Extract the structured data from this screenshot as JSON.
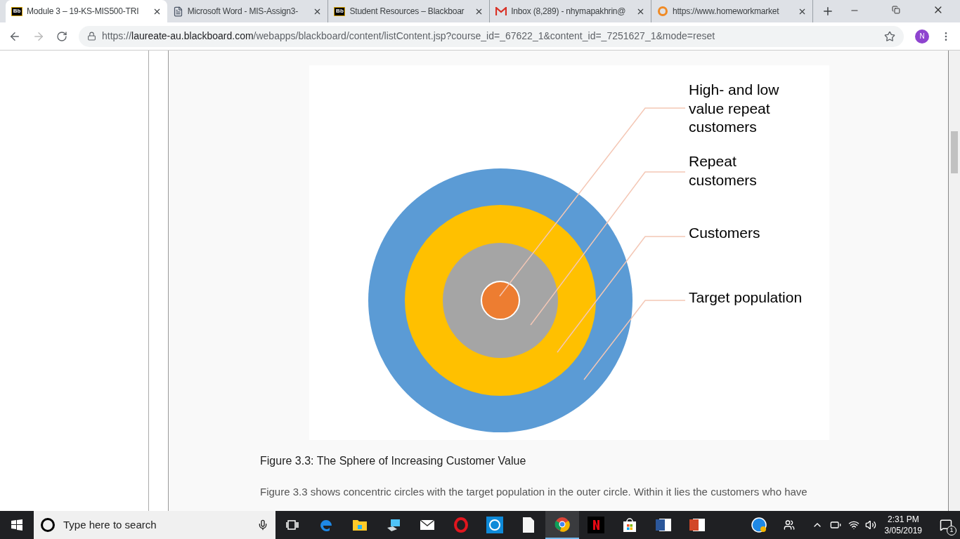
{
  "tabs": [
    {
      "label": "Module 3 – 19-KS-MIS500-TRI",
      "kind": "bb",
      "logo": "Bb",
      "selected": true
    },
    {
      "label": "Microsoft Word - MIS-Assign3-",
      "kind": "doc",
      "selected": false
    },
    {
      "label": "Student Resources – Blackboar",
      "kind": "bb",
      "logo": "Bb",
      "selected": false
    },
    {
      "label": "Inbox (8,289) - nhymapakhrin@",
      "kind": "gmail",
      "selected": false
    },
    {
      "label": "https://www.homeworkmarket",
      "kind": "ring",
      "selected": false
    }
  ],
  "address": {
    "scheme": "https://",
    "host": "laureate-au.blackboard.com",
    "path": "/webapps/blackboard/content/listContent.jsp?course_id=_67622_1&content_id=_7251627_1&mode=reset"
  },
  "avatar": "N",
  "figure": {
    "rings": [
      {
        "color": "#ed7d31"
      },
      {
        "color": "#a5a5a5"
      },
      {
        "color": "#ffc000"
      },
      {
        "color": "#5b9bd5"
      }
    ],
    "labels": [
      [
        "High- and low",
        "value repeat",
        "customers"
      ],
      [
        "Repeat",
        "customers"
      ],
      [
        "Customers"
      ],
      [
        "Target population"
      ]
    ]
  },
  "caption": "Figure 3.3: The Sphere of Increasing Customer Value",
  "paragraph": "Figure 3.3 shows concentric circles with the target population in the outer circle. Within it lies the customers who have",
  "taskbar": {
    "search_placeholder": "Type here to search",
    "time": "2:31 PM",
    "date": "3/05/2019",
    "notifications": "1",
    "apps": [
      {
        "kind": "edge",
        "active": false
      },
      {
        "kind": "folder",
        "active": false
      },
      {
        "kind": "pc",
        "active": false
      },
      {
        "kind": "mail",
        "active": false
      },
      {
        "kind": "opera",
        "active": false
      },
      {
        "kind": "whatsapp",
        "active": false
      },
      {
        "kind": "file",
        "active": false
      },
      {
        "kind": "chrome",
        "active": true
      },
      {
        "kind": "netflix",
        "active": false
      },
      {
        "kind": "store",
        "active": false
      },
      {
        "kind": "word",
        "active": false
      },
      {
        "kind": "powerpoint",
        "active": false
      }
    ]
  }
}
